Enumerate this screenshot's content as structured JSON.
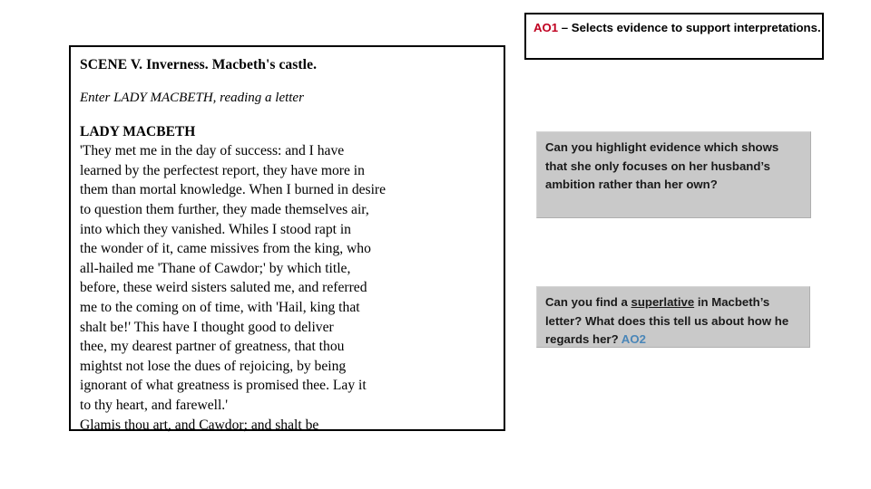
{
  "slide": {
    "extract": {
      "scene_heading": "SCENE V. Inverness. Macbeth's castle.",
      "stage_direction": "Enter LADY MACBETH, reading a letter",
      "speaker": "LADY MACBETH",
      "letter_text": "'They met me in the day of success: and I have\nlearned by the perfectest report, they have more in\nthem than mortal knowledge. When I burned in desire\nto question them further, they made themselves air,\ninto which they vanished. Whiles I stood rapt in\nthe wonder of it, came missives from the king, who\nall-hailed me 'Thane of Cawdor;' by which title,\nbefore, these weird sisters saluted me, and referred\nme to the coming on of time, with 'Hail, king that\nshalt be!' This have I thought good to deliver\nthee, my dearest partner of greatness, that thou\nmightst not lose the dues of rejoicing, by being\nignorant of what greatness is promised thee. Lay it\nto thy heart, and farewell.'\nGlamis thou art, and Cawdor; and shalt be"
    },
    "objective": {
      "code": "AO1",
      "dash": " – ",
      "description": "Selects evidence to support interpretations."
    },
    "questions": [
      {
        "text": "Can you highlight evidence which shows that she only focuses on her husband’s ambition rather than her own?"
      },
      {
        "text_part_1": "Can you find a ",
        "emphasis": "superlative",
        "text_part_2": " in Macbeth’s letter? What does this tell us about how he regards her? ",
        "code": "AO2"
      }
    ],
    "colors": {
      "ao1_red": "#C00020",
      "ao2_blue": "#4A86B8",
      "callout_grey": "#C9C9C9",
      "border_black": "#000000"
    }
  }
}
